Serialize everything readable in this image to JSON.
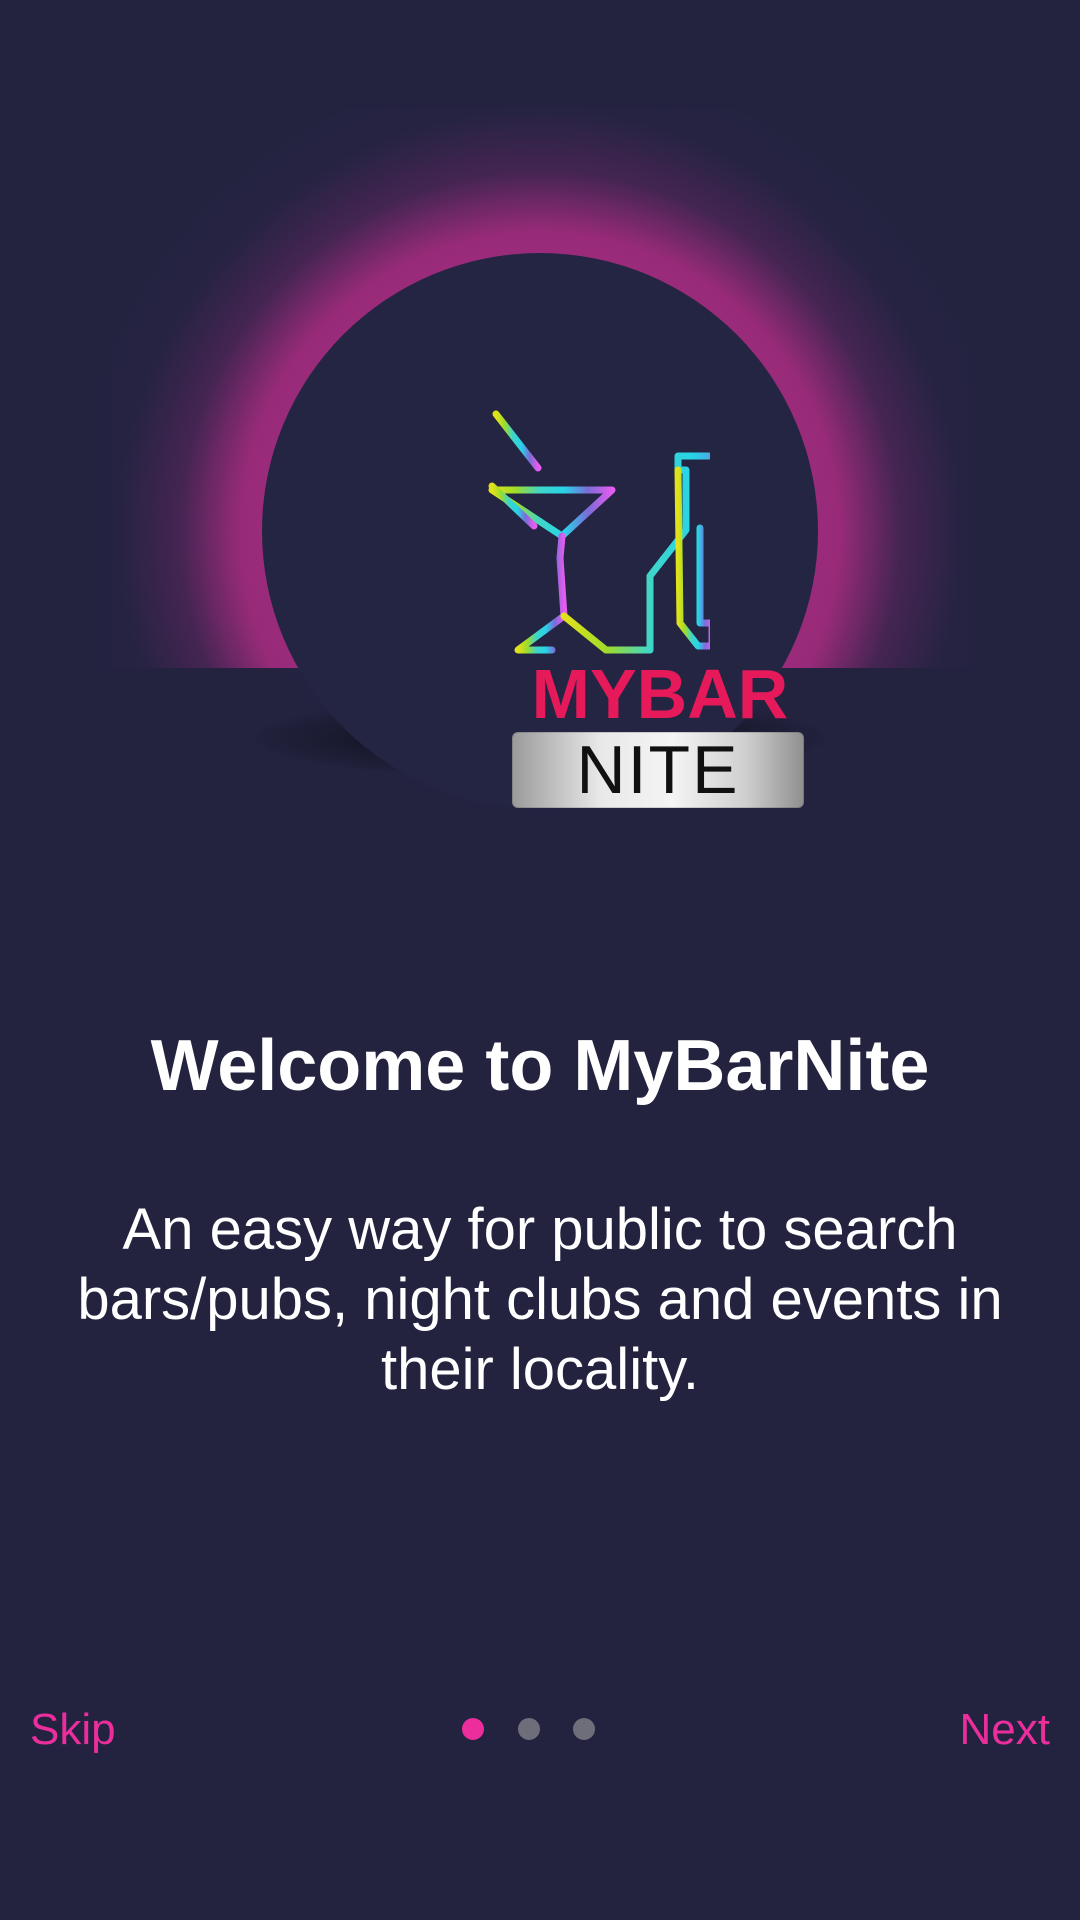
{
  "onboarding": {
    "title": "Welcome to MyBarNite",
    "description": "An easy way for public to search bars/pubs, night clubs and events in their locality.",
    "logo": {
      "top_text": "MYBAR",
      "bottom_text": "NITE"
    }
  },
  "navigation": {
    "skip_label": "Skip",
    "next_label": "Next",
    "pages_total": 3,
    "current_page": 1
  },
  "colors": {
    "background": "#232340",
    "accent": "#ec2e9d",
    "dot_active": "#ec2e9d",
    "dot_inactive": "#6e6e7a",
    "brand_red": "#e6195a"
  }
}
